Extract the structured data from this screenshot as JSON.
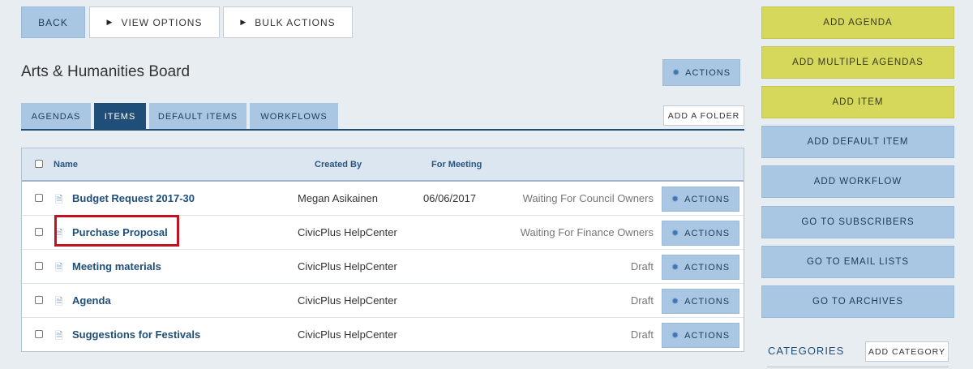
{
  "toolbar": {
    "back": "BACK",
    "view_options": "VIEW OPTIONS",
    "bulk_actions": "BULK ACTIONS"
  },
  "board": {
    "title": "Arts & Humanities Board",
    "actions": "ACTIONS"
  },
  "tabs": [
    "AGENDAS",
    "ITEMS",
    "DEFAULT ITEMS",
    "WORKFLOWS"
  ],
  "active_tab": "ITEMS",
  "add_folder": "ADD A FOLDER",
  "table": {
    "headers": {
      "name": "Name",
      "created_by": "Created By",
      "for_meeting": "For Meeting"
    },
    "rows": [
      {
        "name": "Budget Request 2017-30",
        "created_by": "Megan Asikainen",
        "for_meeting": "06/06/2017",
        "status": "Waiting For Council Owners",
        "action": "ACTIONS"
      },
      {
        "name": "Purchase Proposal",
        "created_by": "CivicPlus HelpCenter",
        "for_meeting": "",
        "status": "Waiting For Finance Owners",
        "action": "ACTIONS"
      },
      {
        "name": "Meeting materials",
        "created_by": "CivicPlus HelpCenter",
        "for_meeting": "",
        "status": "Draft",
        "action": "ACTIONS"
      },
      {
        "name": "Agenda",
        "created_by": "CivicPlus HelpCenter",
        "for_meeting": "",
        "status": "Draft",
        "action": "ACTIONS"
      },
      {
        "name": "Suggestions for Festivals",
        "created_by": "CivicPlus HelpCenter",
        "for_meeting": "",
        "status": "Draft",
        "action": "ACTIONS"
      }
    ]
  },
  "sidebar": {
    "add_agenda": "ADD AGENDA",
    "add_multiple_agendas": "ADD MULTIPLE AGENDAS",
    "add_item": "ADD ITEM",
    "add_default_item": "ADD DEFAULT ITEM",
    "add_workflow": "ADD WORKFLOW",
    "go_to_subscribers": "GO TO SUBSCRIBERS",
    "go_to_email_lists": "GO TO EMAIL LISTS",
    "go_to_archives": "GO TO ARCHIVES",
    "categories": "CATEGORIES",
    "add_category": "ADD CATEGORY"
  },
  "icons": {
    "play": "play-icon",
    "gear": "gear-icon",
    "document": "document-icon"
  },
  "colors": {
    "accent": "#1f4e79",
    "button_blue": "#a9c6e3",
    "button_yellow": "#d5d85a",
    "highlight": "#c1121f"
  }
}
